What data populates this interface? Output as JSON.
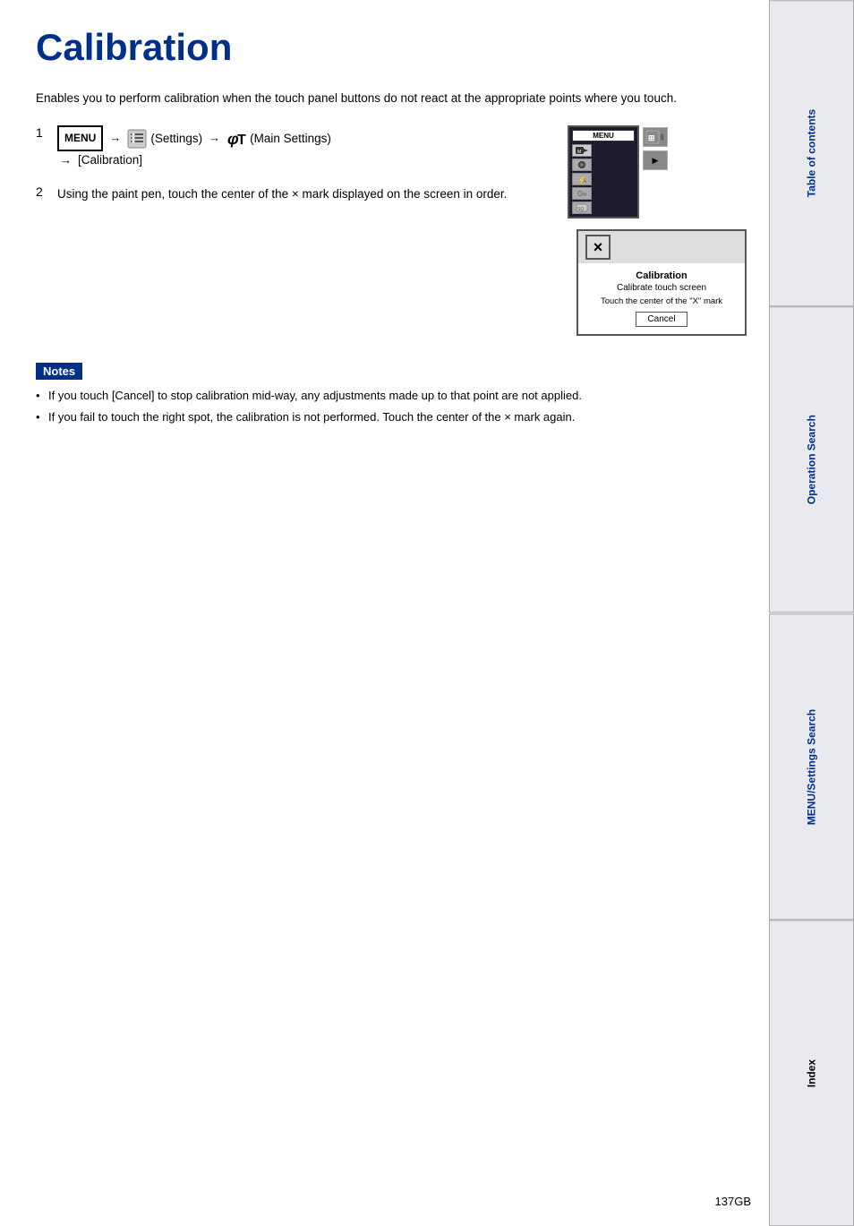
{
  "page": {
    "title": "Calibration",
    "description": "Enables you to perform calibration when the touch panel buttons do not react at the appropriate points where you touch.",
    "steps": [
      {
        "number": "1",
        "parts": [
          "MENU",
          "→",
          "(Settings)",
          "→",
          "(Main Settings)",
          "→",
          "[Calibration]"
        ]
      },
      {
        "number": "2",
        "text": "Using the paint pen, touch the center of the × mark displayed on the screen in order."
      }
    ],
    "notes_label": "Notes",
    "notes": [
      "If you touch [Cancel] to stop calibration mid-way, any adjustments made up to that point are not applied.",
      "If you fail to touch the right spot, the calibration is not performed. Touch the center of the × mark again."
    ],
    "dialog": {
      "title": "Calibration",
      "subtitle": "Calibrate touch screen",
      "instruction": "Touch the center of the \"X\" mark",
      "cancel_button": "Cancel"
    },
    "sidebar": {
      "tabs": [
        "Table of contents",
        "Operation Search",
        "MENU/Settings Search",
        "Index"
      ]
    },
    "page_number": "137GB"
  }
}
